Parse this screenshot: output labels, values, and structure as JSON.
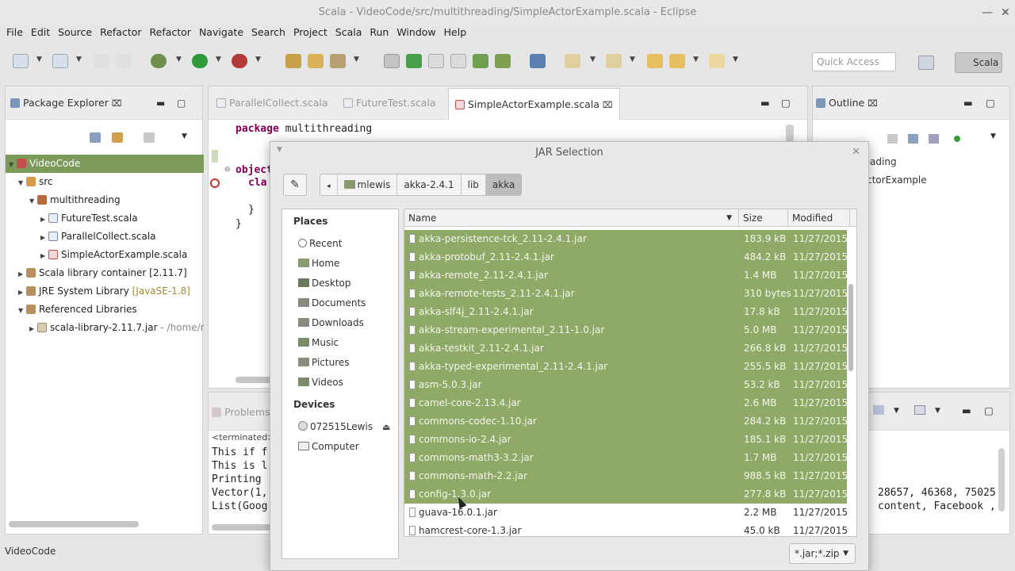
{
  "window": {
    "title": "Scala - VideoCode/src/multithreading/SimpleActorExample.scala - Eclipse"
  },
  "menu": [
    "File",
    "Edit",
    "Source",
    "Refactor",
    "Refactor",
    "Navigate",
    "Search",
    "Project",
    "Scala",
    "Run",
    "Window",
    "Help"
  ],
  "toolbar": {
    "quick_access_placeholder": "Quick Access",
    "perspective": "Scala"
  },
  "package_explorer": {
    "title": "Package Explorer",
    "tree": [
      {
        "label": "VideoCode",
        "selected": true
      },
      {
        "label": "src"
      },
      {
        "label": "multithreading"
      },
      {
        "label": "FutureTest.scala"
      },
      {
        "label": "ParallelCollect.scala"
      },
      {
        "label": "SimpleActorExample.scala"
      },
      {
        "label": "Scala library container [2.11.7]"
      },
      {
        "label": "JRE System Library",
        "suffix": "[JavaSE-1.8]"
      },
      {
        "label": "Referenced Libraries"
      },
      {
        "label": "scala-library-2.11.7.jar",
        "suffix": "- /home/m"
      }
    ]
  },
  "editor": {
    "tabs": [
      "ParallelCollect.scala",
      "FutureTest.scala",
      "SimpleActorExample.scala"
    ],
    "code": {
      "line1_kw": "package",
      "line1_rest": " multithreading",
      "line2": "object",
      "line3": "cla",
      "line4": "}",
      "line5": "}"
    }
  },
  "outline": {
    "title": "Outline",
    "items": [
      "reading",
      "ActorExample"
    ]
  },
  "console": {
    "tab": "Problems",
    "terminated": "<terminated>",
    "lines": [
      "This if f",
      "This is l",
      "Printing ",
      "Vector(1,",
      "List(Goog"
    ],
    "right_lines": [
      "28657, 46368, 75025",
      "content, Facebook ,"
    ]
  },
  "status": {
    "text": "VideoCode"
  },
  "dialog": {
    "title": "JAR Selection",
    "breadcrumbs": [
      "mlewis",
      "akka-2.4.1",
      "lib",
      "akka"
    ],
    "places_title": "Places",
    "places": [
      "Recent",
      "Home",
      "Desktop",
      "Documents",
      "Downloads",
      "Music",
      "Pictures",
      "Videos"
    ],
    "devices_title": "Devices",
    "devices": [
      "072515Lewis",
      "Computer"
    ],
    "columns": {
      "name": "Name",
      "size": "Size",
      "modified": "Modified"
    },
    "files": [
      {
        "name": "akka-persistence-tck_2.11-2.4.1.jar",
        "size": "183.9 kB",
        "modified": "11/27/2015",
        "selected": true
      },
      {
        "name": "akka-protobuf_2.11-2.4.1.jar",
        "size": "484.2 kB",
        "modified": "11/27/2015",
        "selected": true
      },
      {
        "name": "akka-remote_2.11-2.4.1.jar",
        "size": "1.4 MB",
        "modified": "11/27/2015",
        "selected": true
      },
      {
        "name": "akka-remote-tests_2.11-2.4.1.jar",
        "size": "310 bytes",
        "modified": "11/27/2015",
        "selected": true
      },
      {
        "name": "akka-slf4j_2.11-2.4.1.jar",
        "size": "17.8 kB",
        "modified": "11/27/2015",
        "selected": true
      },
      {
        "name": "akka-stream-experimental_2.11-1.0.jar",
        "size": "5.0 MB",
        "modified": "11/27/2015",
        "selected": true
      },
      {
        "name": "akka-testkit_2.11-2.4.1.jar",
        "size": "266.8 kB",
        "modified": "11/27/2015",
        "selected": true
      },
      {
        "name": "akka-typed-experimental_2.11-2.4.1.jar",
        "size": "255.5 kB",
        "modified": "11/27/2015",
        "selected": true
      },
      {
        "name": "asm-5.0.3.jar",
        "size": "53.2 kB",
        "modified": "11/27/2015",
        "selected": true
      },
      {
        "name": "camel-core-2.13.4.jar",
        "size": "2.6 MB",
        "modified": "11/27/2015",
        "selected": true
      },
      {
        "name": "commons-codec-1.10.jar",
        "size": "284.2 kB",
        "modified": "11/27/2015",
        "selected": true
      },
      {
        "name": "commons-io-2.4.jar",
        "size": "185.1 kB",
        "modified": "11/27/2015",
        "selected": true
      },
      {
        "name": "commons-math3-3.2.jar",
        "size": "1.7 MB",
        "modified": "11/27/2015",
        "selected": true
      },
      {
        "name": "commons-math-2.2.jar",
        "size": "988.5 kB",
        "modified": "11/27/2015",
        "selected": true
      },
      {
        "name": "config-1.3.0.jar",
        "size": "277.8 kB",
        "modified": "11/27/2015",
        "selected": true
      },
      {
        "name": "guava-16.0.1.jar",
        "size": "2.2 MB",
        "modified": "11/27/2015",
        "selected": false
      },
      {
        "name": "hamcrest-core-1.3.jar",
        "size": "45.0 kB",
        "modified": "11/27/2015",
        "selected": false
      }
    ],
    "filter": "*.jar;*.zip"
  },
  "colors": {
    "selection": "#8fa966",
    "tree_selection": "#7c9a5a",
    "keyword": "#7f0055"
  }
}
